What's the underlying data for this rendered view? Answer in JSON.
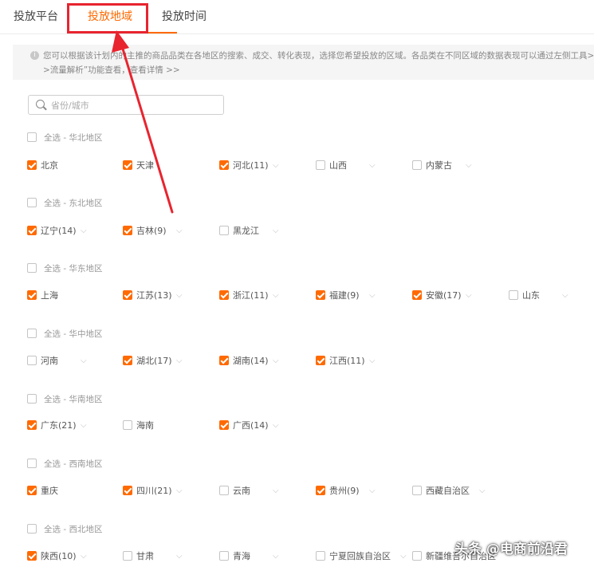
{
  "tabs": {
    "platform": "投放平台",
    "region": "投放地域",
    "time": "投放时间"
  },
  "notice": {
    "line1": "您可以根据该计划内的主推的商品品类在各地区的搜索、成交、转化表现，选择您希望投放的区域。各品类在不同区域的数据表现可以通过左侧工具>",
    "line2": ">流量解析”功能查看，查看详情 >>"
  },
  "search": {
    "placeholder": "省份/城市"
  },
  "regions": {
    "huabei": {
      "label": "全选 - 华北地区",
      "p": [
        {
          "name": "北京",
          "checked": true
        },
        {
          "name": "天津",
          "checked": true
        },
        {
          "name": "河北(11)",
          "checked": true
        },
        {
          "name": "山西",
          "checked": false
        },
        {
          "name": "内蒙古",
          "checked": false
        }
      ]
    },
    "dongbei": {
      "label": "全选 - 东北地区",
      "p": [
        {
          "name": "辽宁(14)",
          "checked": true
        },
        {
          "name": "吉林(9)",
          "checked": true
        },
        {
          "name": "黑龙江",
          "checked": false
        }
      ]
    },
    "huadong": {
      "label": "全选 - 华东地区",
      "p": [
        {
          "name": "上海",
          "checked": true
        },
        {
          "name": "江苏(13)",
          "checked": true
        },
        {
          "name": "浙江(11)",
          "checked": true
        },
        {
          "name": "福建(9)",
          "checked": true
        },
        {
          "name": "安徽(17)",
          "checked": true
        },
        {
          "name": "山东",
          "checked": false
        }
      ]
    },
    "huazhong": {
      "label": "全选 - 华中地区",
      "p": [
        {
          "name": "河南",
          "checked": false
        },
        {
          "name": "湖北(17)",
          "checked": true
        },
        {
          "name": "湖南(14)",
          "checked": true
        },
        {
          "name": "江西(11)",
          "checked": true
        }
      ]
    },
    "huanan": {
      "label": "全选 - 华南地区",
      "p": [
        {
          "name": "广东(21)",
          "checked": true
        },
        {
          "name": "海南",
          "checked": false
        },
        {
          "name": "广西(14)",
          "checked": true
        }
      ]
    },
    "xinan": {
      "label": "全选 - 西南地区",
      "p": [
        {
          "name": "重庆",
          "checked": true
        },
        {
          "name": "四川(21)",
          "checked": true
        },
        {
          "name": "云南",
          "checked": false
        },
        {
          "name": "贵州(9)",
          "checked": true
        },
        {
          "name": "西藏自治区",
          "checked": false
        }
      ]
    },
    "xibei": {
      "label": "全选 - 西北地区",
      "p": [
        {
          "name": "陕西(10)",
          "checked": true
        },
        {
          "name": "甘肃",
          "checked": false
        },
        {
          "name": "青海",
          "checked": false
        },
        {
          "name": "宁夏回族自治区",
          "checked": false
        },
        {
          "name": "新疆维吾尔自治区",
          "checked": false
        }
      ]
    }
  },
  "watermark": "头条 @电商前沿君",
  "colors": {
    "accent": "#ff6a00",
    "annotation": "#e8242f"
  }
}
